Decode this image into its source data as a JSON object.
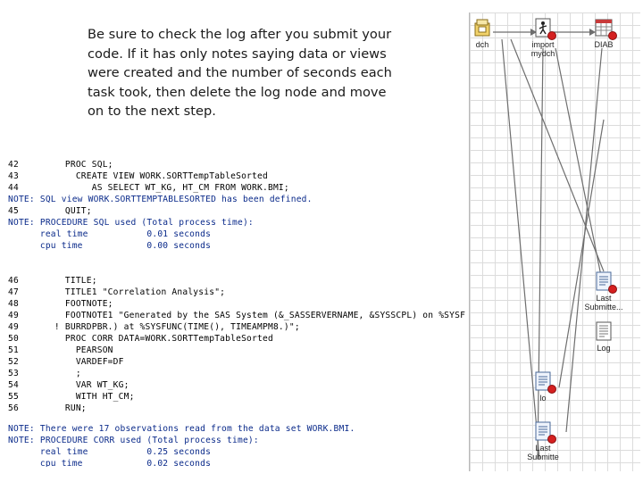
{
  "instruction": {
    "lines": [
      "Be sure to check the log after you submit your",
      "code.  If it has only notes saying data or views",
      "were created and the number of seconds each",
      "task took, then delete the log node and move",
      "on to the next step."
    ]
  },
  "log": {
    "lines": [
      {
        "num": "42",
        "text": "     PROC SQL;"
      },
      {
        "num": "43",
        "text": "       CREATE VIEW WORK.SORTTempTableSorted"
      },
      {
        "num": "44",
        "text": "          AS SELECT WT_KG, HT_CM FROM WORK.BMI;"
      },
      {
        "num": "",
        "text": "NOTE: SQL view WORK.SORTTEMPTABLESORTED has been defined."
      },
      {
        "num": "45",
        "text": "     QUIT;"
      },
      {
        "num": "",
        "text": "NOTE: PROCEDURE SQL used (Total process time):"
      },
      {
        "num": "",
        "text": "      real time           0.01 seconds"
      },
      {
        "num": "",
        "text": "      cpu time            0.00 seconds"
      },
      {
        "num": "46",
        "text": "     TITLE;"
      },
      {
        "num": "47",
        "text": "     TITLE1 \"Correlation Analysis\";"
      },
      {
        "num": "48",
        "text": "     FOOTNOTE;"
      },
      {
        "num": "49",
        "text": "     FOOTNOTE1 \"Generated by the SAS System (&_SASSERVERNAME, &SYSSCPL) on %SYSF"
      },
      {
        "num": "49",
        "text": "   ! BURRDPBR.) at %SYSFUNC(TIME(), TIMEAMPM8.)\";"
      },
      {
        "num": "50",
        "text": "     PROC CORR DATA=WORK.SORTTempTableSorted"
      },
      {
        "num": "51",
        "text": "       PEARSON"
      },
      {
        "num": "52",
        "text": "       VARDEF=DF"
      },
      {
        "num": "53",
        "text": "       ;"
      },
      {
        "num": "54",
        "text": "       VAR WT_KG;"
      },
      {
        "num": "55",
        "text": "       WITH HT_CM;"
      },
      {
        "num": "56",
        "text": "     RUN;"
      },
      {
        "num": "",
        "text": "NOTE: There were 17 observations read from the data set WORK.BMI."
      },
      {
        "num": "",
        "text": "NOTE: PROCEDURE CORR used (Total process time):"
      },
      {
        "num": "",
        "text": "      real time           0.25 seconds"
      },
      {
        "num": "",
        "text": "      cpu time            0.02 seconds"
      }
    ]
  },
  "flow": {
    "nodes": [
      {
        "label": "dch",
        "icon": "library-icon",
        "status": "none"
      },
      {
        "label": "import mydch",
        "icon": "import-data-icon",
        "status": "error"
      },
      {
        "label": "DIAB",
        "icon": "data-table-icon",
        "status": "error"
      },
      {
        "label": "Last Submitte...",
        "icon": "program-icon",
        "status": "error"
      },
      {
        "label": "Log",
        "icon": "log-icon",
        "status": "none"
      },
      {
        "label": "lo",
        "icon": "program-icon",
        "status": "error"
      },
      {
        "label": "Last Submitte",
        "icon": "program-icon",
        "status": "error"
      }
    ]
  },
  "colors": {
    "note_text": "#0a2a8a",
    "status_dot": "#d42020",
    "link_line": "#6e6e6e"
  }
}
